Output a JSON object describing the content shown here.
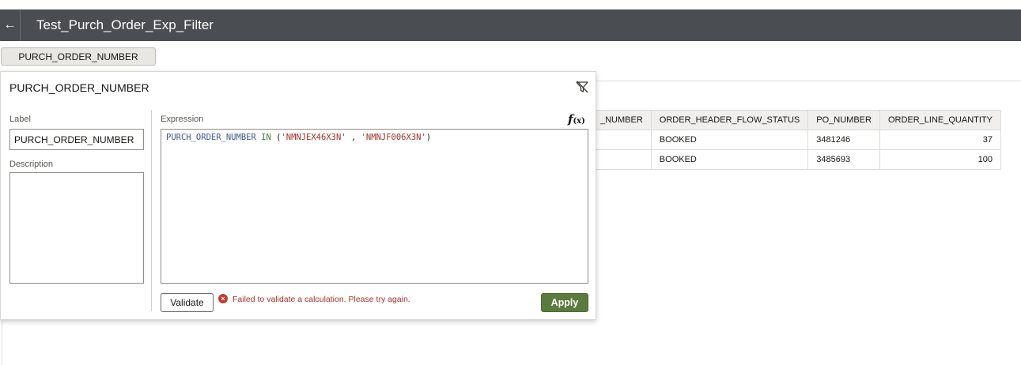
{
  "header": {
    "back_icon": "arrow-left-icon",
    "title": "Test_Purch_Order_Exp_Filter"
  },
  "filter_bar": {
    "pill_label": "PURCH_ORDER_NUMBER"
  },
  "table": {
    "columns": [
      "_NUMBER",
      "ORDER_HEADER_FLOW_STATUS",
      "PO_NUMBER",
      "ORDER_LINE_QUANTITY"
    ],
    "rows": [
      [
        "",
        "BOOKED",
        "3481246",
        "37"
      ],
      [
        "",
        "BOOKED",
        "3485693",
        "100"
      ]
    ]
  },
  "popup": {
    "title": "PURCH_ORDER_NUMBER",
    "clear_icon": "clear-filter-icon",
    "label_caption": "Label",
    "label_value": "PURCH_ORDER_NUMBER",
    "description_caption": "Description",
    "description_value": "",
    "expression_caption": "Expression",
    "fx_icon": "function-icon",
    "fx_symbol": "f",
    "fx_sub": "(x)",
    "expression": {
      "column": "PURCH_ORDER_NUMBER",
      "keyword": "IN",
      "open": "(",
      "value1": "'NMNJEX46X3N'",
      "sep": ",",
      "value2": "'NMNJF006X3N'",
      "close": ")"
    },
    "validate_label": "Validate",
    "error_icon": "error-icon",
    "error_text": "Failed to validate a calculation. Please try again.",
    "apply_label": "Apply",
    "colors": {
      "apply_bg": "#5b7a3e",
      "error": "#a9322a",
      "header_bg": "#4a4d52"
    }
  }
}
